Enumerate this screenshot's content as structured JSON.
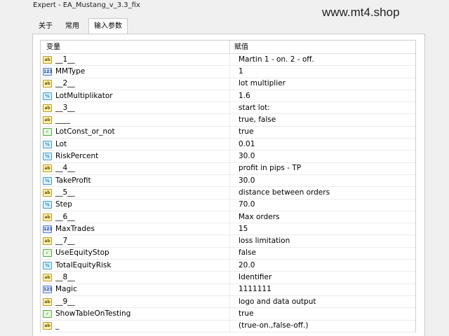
{
  "window": {
    "title": "Expert - EA_Mustang_v_3.3_fix"
  },
  "watermark": "www.mt4.shop",
  "tabs": [
    {
      "label": "关于"
    },
    {
      "label": "常用"
    },
    {
      "label": "输入参数"
    }
  ],
  "table": {
    "headers": {
      "variable": "变量",
      "value": "赋值"
    },
    "rows": [
      {
        "type": "string",
        "icon": "ab",
        "name": "__1__",
        "value": " Martin 1 - on. 2 - off."
      },
      {
        "type": "int",
        "icon": "123",
        "name": "MMType",
        "value": "1"
      },
      {
        "type": "string",
        "icon": "ab",
        "name": "__2__",
        "value": "lot multiplier"
      },
      {
        "type": "double",
        "icon": "½",
        "name": "LotMultiplikator",
        "value": "1.6"
      },
      {
        "type": "string",
        "icon": "ab",
        "name": "__3__",
        "value": "start lot:"
      },
      {
        "type": "string",
        "icon": "ab",
        "name": "____",
        "value": "true, false"
      },
      {
        "type": "bool",
        "icon": "✓",
        "name": "LotConst_or_not",
        "value": "true"
      },
      {
        "type": "double",
        "icon": "½",
        "name": "Lot",
        "value": "0.01"
      },
      {
        "type": "double",
        "icon": "½",
        "name": "RiskPercent",
        "value": "30.0"
      },
      {
        "type": "string",
        "icon": "ab",
        "name": "__4__",
        "value": "profit in pips - TP"
      },
      {
        "type": "double",
        "icon": "½",
        "name": "TakeProfit",
        "value": "30.0"
      },
      {
        "type": "string",
        "icon": "ab",
        "name": "__5__",
        "value": "distance between orders"
      },
      {
        "type": "double",
        "icon": "½",
        "name": "Step",
        "value": "70.0"
      },
      {
        "type": "string",
        "icon": "ab",
        "name": "__6__",
        "value": "Max orders"
      },
      {
        "type": "int",
        "icon": "123",
        "name": "MaxTrades",
        "value": "15"
      },
      {
        "type": "string",
        "icon": "ab",
        "name": "__7__",
        "value": "loss limitation"
      },
      {
        "type": "bool",
        "icon": "✓",
        "name": "UseEquityStop",
        "value": "false"
      },
      {
        "type": "double",
        "icon": "½",
        "name": "TotalEquityRisk",
        "value": "20.0"
      },
      {
        "type": "string",
        "icon": "ab",
        "name": "__8__",
        "value": "Identifier"
      },
      {
        "type": "int",
        "icon": "123",
        "name": "Magic",
        "value": "1111111"
      },
      {
        "type": "string",
        "icon": "ab",
        "name": "__9__",
        "value": "logo and data output"
      },
      {
        "type": "bool",
        "icon": "✓",
        "name": "ShowTableOnTesting",
        "value": "true"
      },
      {
        "type": "string",
        "icon": "ab",
        "name": "_",
        "value": "(true-on.,false-off.)"
      }
    ]
  }
}
